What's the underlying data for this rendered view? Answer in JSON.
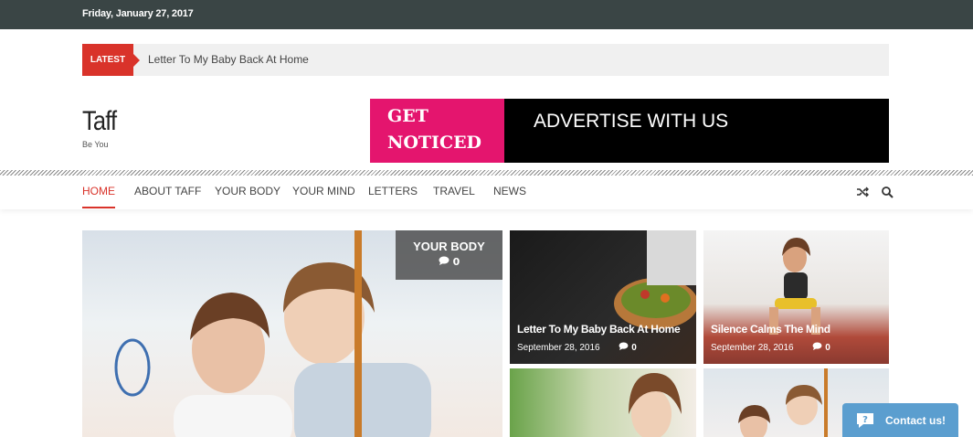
{
  "topbar": {
    "date": "Friday, January 27, 2017"
  },
  "ticker": {
    "label": "LATEST",
    "headline": "Letter To My Baby Back At Home"
  },
  "site": {
    "title": "Taff",
    "tagline": "Be You"
  },
  "ad": {
    "line1": "GET",
    "line2": "NOTICED",
    "text": "ADVERTISE WITH US"
  },
  "nav": {
    "items": [
      {
        "label": "HOME",
        "active": true
      },
      {
        "label": "ABOUT TAFF"
      },
      {
        "label": "YOUR BODY"
      },
      {
        "label": "YOUR MIND"
      },
      {
        "label": "LETTERS"
      },
      {
        "label": "TRAVEL"
      },
      {
        "label": "NEWS"
      }
    ],
    "icons": [
      "shuffle-icon",
      "search-icon"
    ]
  },
  "hero": {
    "category": "YOUR BODY",
    "comments": "0"
  },
  "cards": [
    {
      "title": "Letter To My Baby Back At Home",
      "date": "September 28, 2016",
      "comments": "0"
    },
    {
      "title": "Silence Calms The Mind",
      "date": "September 28, 2016",
      "comments": "0"
    }
  ],
  "contact": {
    "label": "Contact us!"
  },
  "colors": {
    "accent": "#d9332a",
    "topbar": "#3a4545",
    "ad_pink": "#e4156e",
    "contact": "#5b9ecf"
  }
}
